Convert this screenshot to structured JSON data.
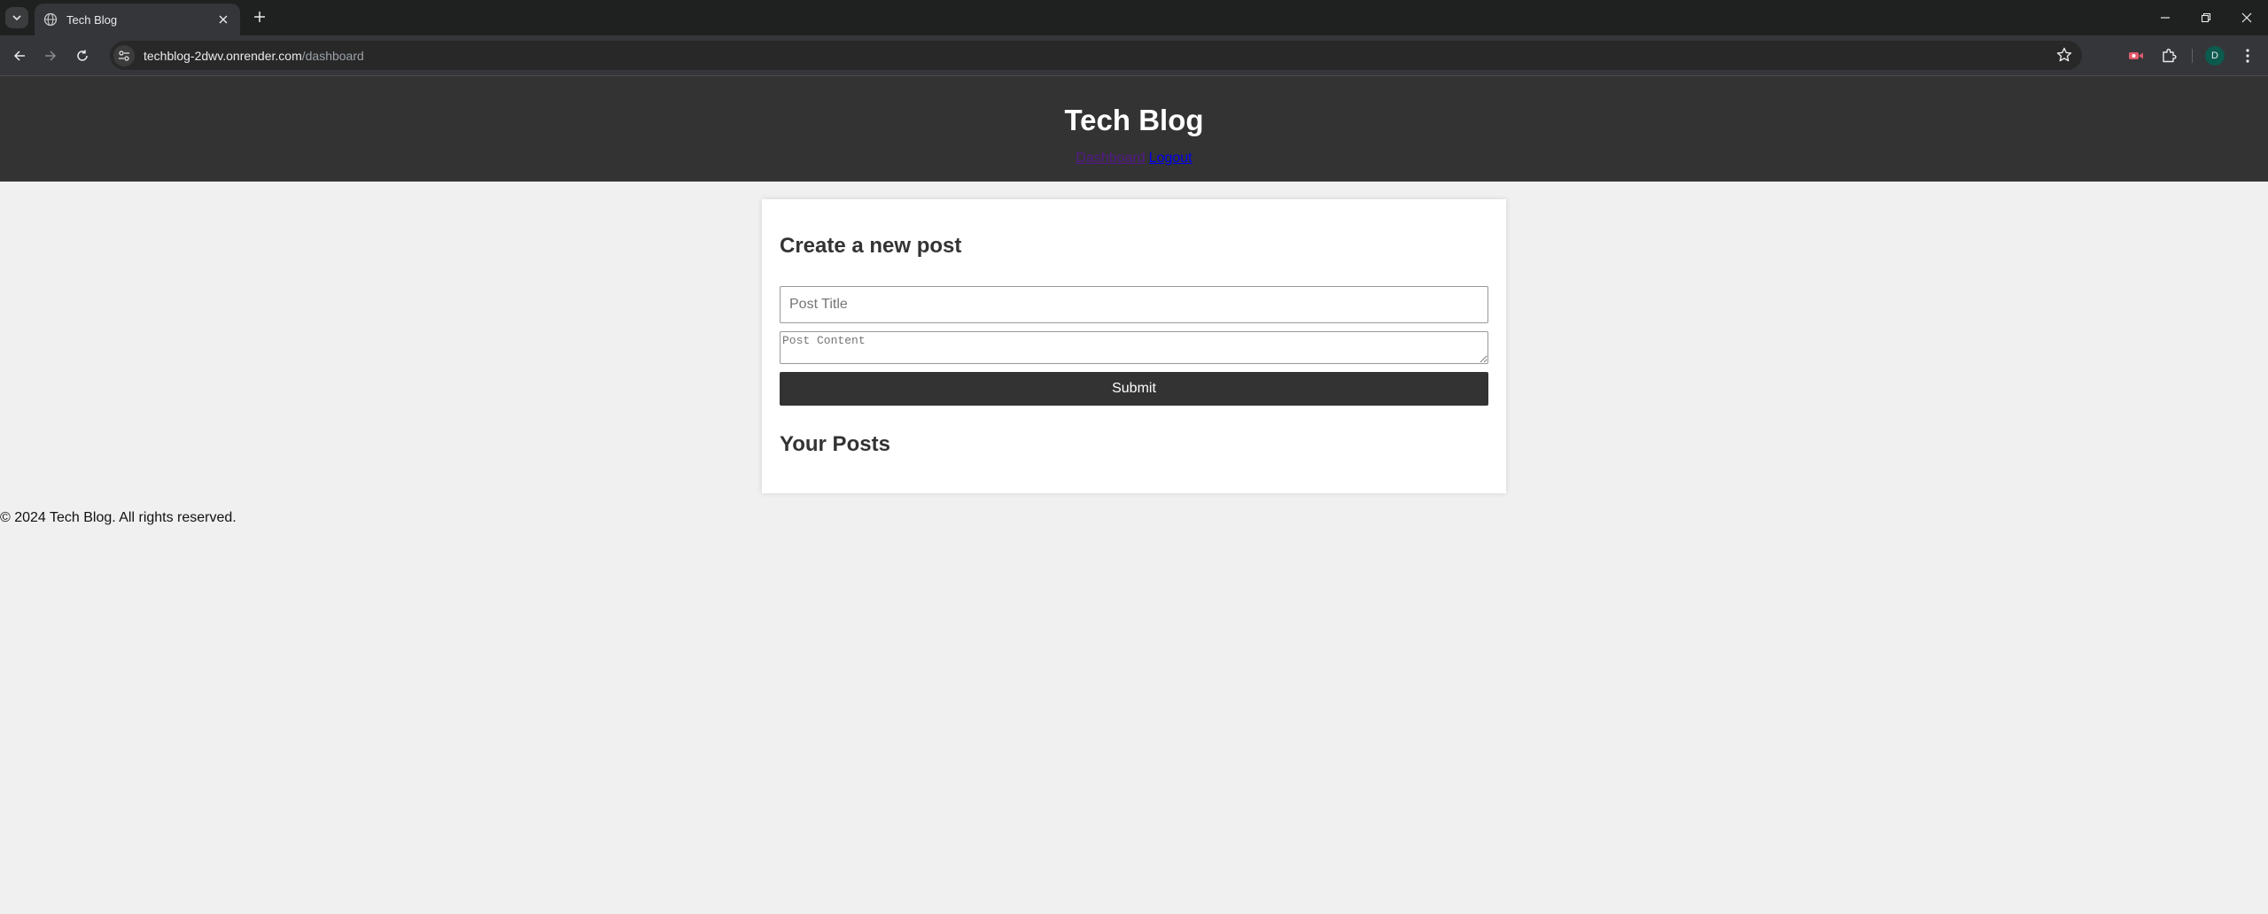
{
  "browser": {
    "tab_title": "Tech Blog",
    "url_host": "techblog-2dwv.onrender.com",
    "url_path": "/dashboard",
    "profile_initial": "D"
  },
  "header": {
    "title": "Tech Blog",
    "nav": {
      "dashboard_label": "Dashboard",
      "logout_label": "Logout"
    }
  },
  "create_post": {
    "heading": "Create a new post",
    "title_placeholder": "Post Title",
    "title_value": "",
    "content_placeholder": "Post Content",
    "content_value": "",
    "submit_label": "Submit"
  },
  "your_posts": {
    "heading": "Your Posts",
    "items": []
  },
  "footer": {
    "text": "© 2024 Tech Blog. All rights reserved."
  },
  "colors": {
    "header_bg": "#333333",
    "page_bg": "#f0f0f0",
    "card_bg": "#ffffff",
    "button_bg": "#333333",
    "visited_link": "#551a8b",
    "link": "#0000ee"
  },
  "icons": [
    "tab-search-icon",
    "globe-icon",
    "close-icon",
    "plus-icon",
    "minimize-icon",
    "restore-icon",
    "window-close-icon",
    "back-icon",
    "forward-icon",
    "reload-icon",
    "site-info-icon",
    "star-icon",
    "recorder-extension-icon",
    "puzzle-icon",
    "kebab-menu-icon"
  ]
}
